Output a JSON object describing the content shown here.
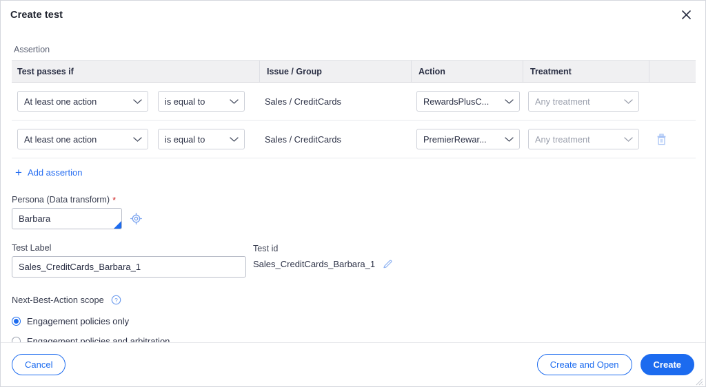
{
  "dialog": {
    "title": "Create test",
    "close_icon": "close-icon"
  },
  "assertion": {
    "section_label": "Assertion",
    "columns": [
      "Test passes if",
      "Issue / Group",
      "Action",
      "Treatment",
      ""
    ],
    "rows": [
      {
        "passes_if": "At least one action",
        "operator": "is equal to",
        "issue_group": "Sales / CreditCards",
        "action": "RewardsPlusC...",
        "treatment": "Any treatment",
        "treatment_is_placeholder": true,
        "has_delete": false
      },
      {
        "passes_if": "At least one action",
        "operator": "is equal to",
        "issue_group": "Sales / CreditCards",
        "action": "PremierRewar...",
        "treatment": "Any treatment",
        "treatment_is_placeholder": true,
        "has_delete": true
      }
    ],
    "add_label": "Add assertion",
    "delete_icon": "trash-icon",
    "add_icon": "plus-icon"
  },
  "persona": {
    "label": "Persona (Data transform)",
    "required_marker": "*",
    "value": "Barbara",
    "picker_icon": "target-picker-icon"
  },
  "test_label": {
    "label": "Test Label",
    "value": "Sales_CreditCards_Barbara_1"
  },
  "test_id": {
    "label": "Test id",
    "value": "Sales_CreditCards_Barbara_1",
    "edit_icon": "pencil-icon"
  },
  "nba_scope": {
    "title": "Next-Best-Action scope",
    "help_icon": "help-circle-icon",
    "options": [
      {
        "label": "Engagement policies only",
        "selected": true
      },
      {
        "label": "Engagement policies and arbitration",
        "selected": false
      }
    ]
  },
  "footer": {
    "cancel": "Cancel",
    "create_and_open": "Create and Open",
    "create": "Create"
  },
  "colors": {
    "accent": "#1c6bef",
    "link": "#276ef1",
    "required": "#cf2424",
    "header_bg": "#f0f0f2",
    "text": "#2b3045",
    "placeholder": "#9ba0ad"
  }
}
